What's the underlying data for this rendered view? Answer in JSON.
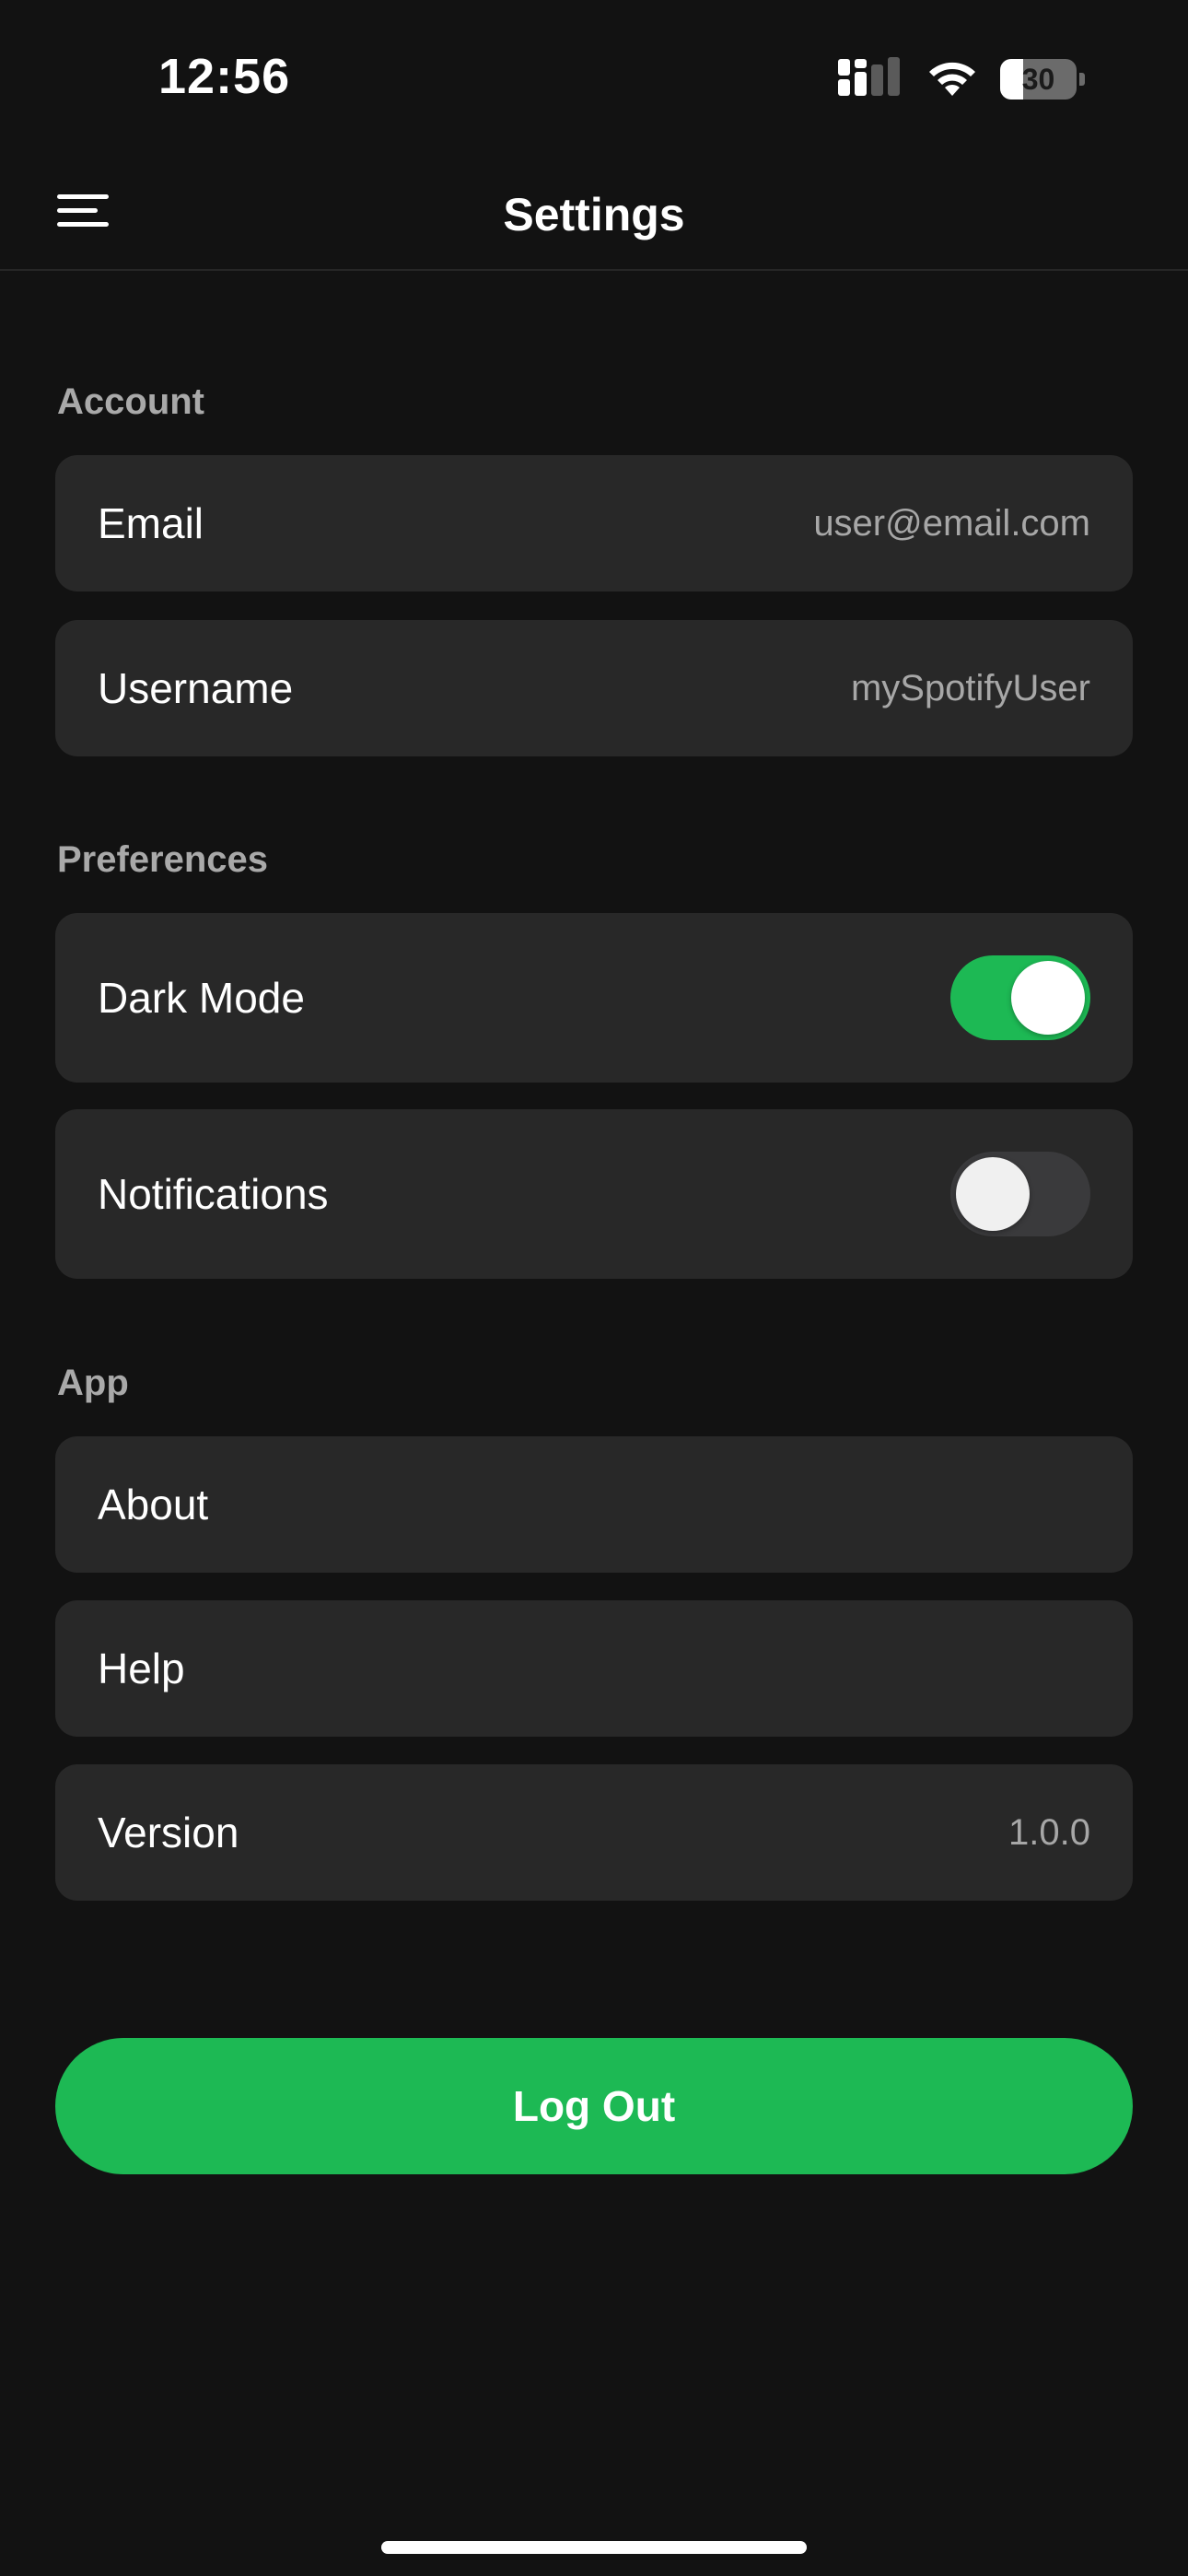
{
  "status_bar": {
    "time": "12:56",
    "battery_level": "30",
    "battery_fraction": 0.3,
    "icons": [
      "cellular-signal-icon",
      "wifi-icon",
      "battery-icon"
    ]
  },
  "nav": {
    "title": "Settings",
    "menu_icon": "hamburger-menu-icon"
  },
  "sections": {
    "account": {
      "label": "Account",
      "email_label": "Email",
      "email_value": "user@email.com",
      "username_label": "Username",
      "username_value": "mySpotifyUser"
    },
    "preferences": {
      "label": "Preferences",
      "dark_mode_label": "Dark Mode",
      "dark_mode_on": true,
      "notifications_label": "Notifications",
      "notifications_on": false
    },
    "app": {
      "label": "App",
      "about_label": "About",
      "help_label": "Help",
      "version_label": "Version",
      "version_value": "1.0.0"
    }
  },
  "logout_label": "Log Out",
  "colors": {
    "background": "#121212",
    "row_background": "#282828",
    "accent_green": "#1db954",
    "section_label": "#a9a9a9",
    "secondary_text": "#a7a7a7",
    "toggle_off": "#3a3a3c"
  }
}
